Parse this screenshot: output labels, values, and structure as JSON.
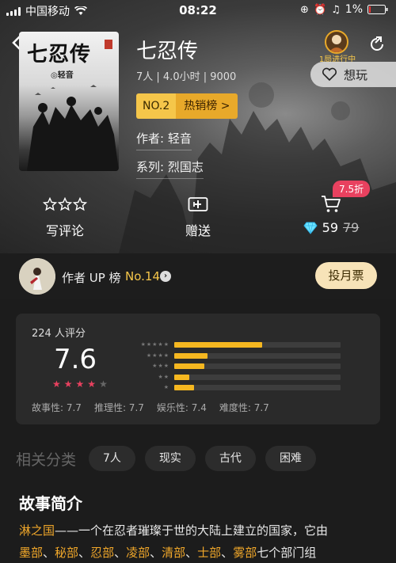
{
  "status_bar": {
    "carrier": "中国移动",
    "time": "08:22",
    "battery": "1%"
  },
  "book": {
    "title": "七忍传",
    "meta": "7人 | 4.0小时 | 9000",
    "cover_title": "七忍传",
    "cover_author": "◎轻音",
    "rank_no": "NO.2",
    "rank_name": "热销榜 >",
    "author_line": "作者: 轻音",
    "series_line": "系列: 烈国志"
  },
  "top_right": {
    "progress_label": "1局进行中",
    "want_label": "想玩"
  },
  "actions": {
    "review_label": "写评论",
    "gift_label": "赠送",
    "discount": "7.5折",
    "price_now": "59",
    "price_old": "79"
  },
  "author_up": {
    "label": "作者 UP 榜",
    "rank": "No.14",
    "vote_label": "投月票"
  },
  "rating": {
    "count_text": "224 人评分",
    "score": "7.6",
    "stars_filled": 4,
    "stars_total": 5,
    "distribution": [
      {
        "stars": 5,
        "fraction": 0.53
      },
      {
        "stars": 4,
        "fraction": 0.2
      },
      {
        "stars": 3,
        "fraction": 0.18
      },
      {
        "stars": 2,
        "fraction": 0.09
      },
      {
        "stars": 1,
        "fraction": 0.12
      }
    ],
    "dimensions": [
      {
        "label": "故事性:",
        "value": "7.7"
      },
      {
        "label": "推理性:",
        "value": "7.7"
      },
      {
        "label": "娱乐性:",
        "value": "7.4"
      },
      {
        "label": "难度性:",
        "value": "7.7"
      }
    ]
  },
  "categories": {
    "title": "相关分类",
    "tags": [
      "7人",
      "现实",
      "古代",
      "困难"
    ]
  },
  "story": {
    "title": "故事简介",
    "line1_hl": "淋之国",
    "line1_rest": "——一个在忍者璀璨于世的大陆上建立的国家，它由",
    "line2_parts": [
      {
        "text": "墨部",
        "hl": true
      },
      {
        "text": "、",
        "hl": false
      },
      {
        "text": "秘部",
        "hl": true
      },
      {
        "text": "、",
        "hl": false
      },
      {
        "text": "忍部",
        "hl": true
      },
      {
        "text": "、",
        "hl": false
      },
      {
        "text": "凌部",
        "hl": true
      },
      {
        "text": "、",
        "hl": false
      },
      {
        "text": "清部",
        "hl": true
      },
      {
        "text": "、",
        "hl": false
      },
      {
        "text": "士部",
        "hl": true
      },
      {
        "text": "、",
        "hl": false
      },
      {
        "text": "雾部",
        "hl": true
      },
      {
        "text": "七个部门组",
        "hl": false
      }
    ]
  },
  "colors": {
    "accent_gold": "#f5c64a",
    "accent_orange": "#f0a72a",
    "discount_pink": "#e8415f",
    "bar_fill": "#f5b720"
  }
}
